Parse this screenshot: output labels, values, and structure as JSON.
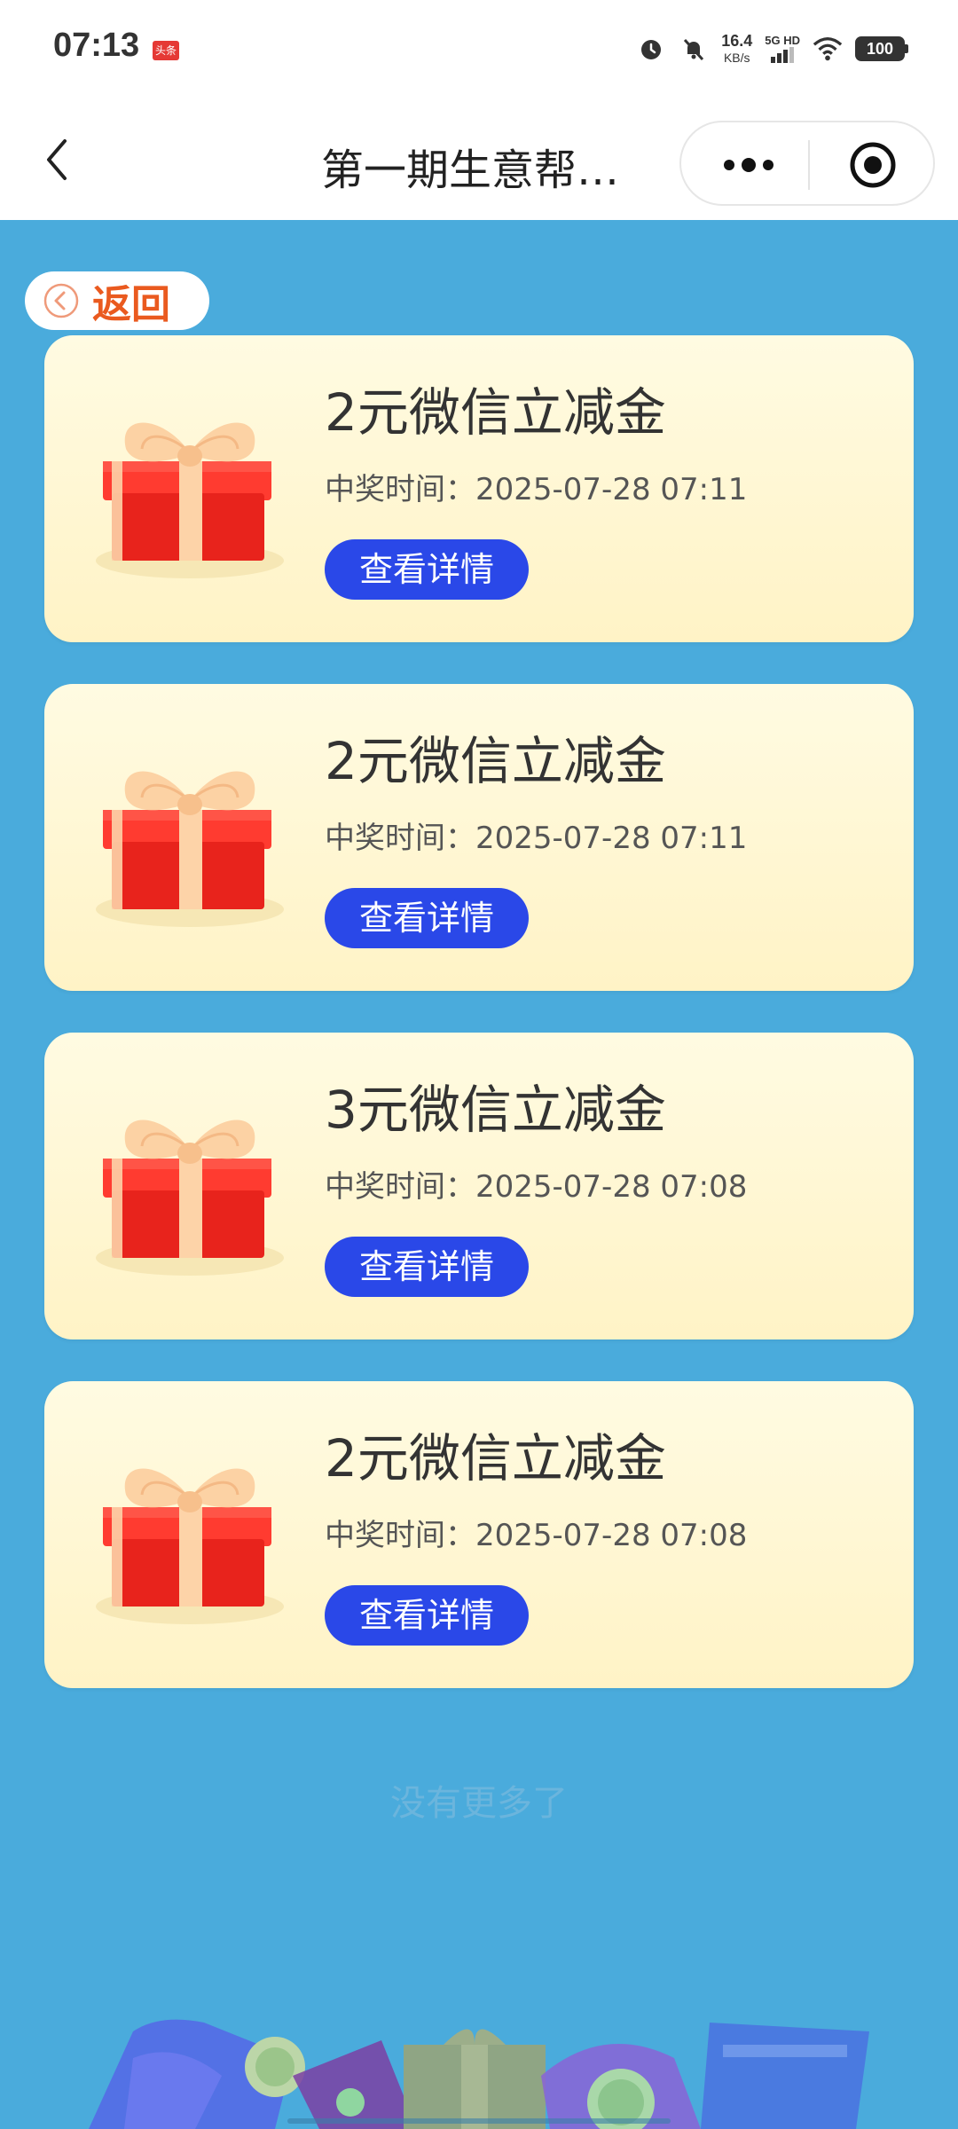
{
  "status_bar": {
    "time": "07:13",
    "app_badge": "头条",
    "net_speed_value": "16.4",
    "net_speed_unit": "KB/s",
    "network_label": "5G HD",
    "battery": "100"
  },
  "nav": {
    "title": "第一期生意帮…"
  },
  "page": {
    "back_label": "返回",
    "no_more_text": "没有更多了"
  },
  "prizes": [
    {
      "title": "2元微信立减金",
      "time": "中奖时间：2025-07-28 07:11",
      "button": "查看详情"
    },
    {
      "title": "2元微信立减金",
      "time": "中奖时间：2025-07-28 07:11",
      "button": "查看详情"
    },
    {
      "title": "3元微信立减金",
      "time": "中奖时间：2025-07-28 07:08",
      "button": "查看详情"
    },
    {
      "title": "2元微信立减金",
      "time": "中奖时间：2025-07-28 07:08",
      "button": "查看详情"
    }
  ],
  "colors": {
    "background": "#4aabdc",
    "card": "#fff6d4",
    "button": "#2a48e8",
    "back_text": "#ea5a1f",
    "gift_red": "#f12f2a"
  }
}
